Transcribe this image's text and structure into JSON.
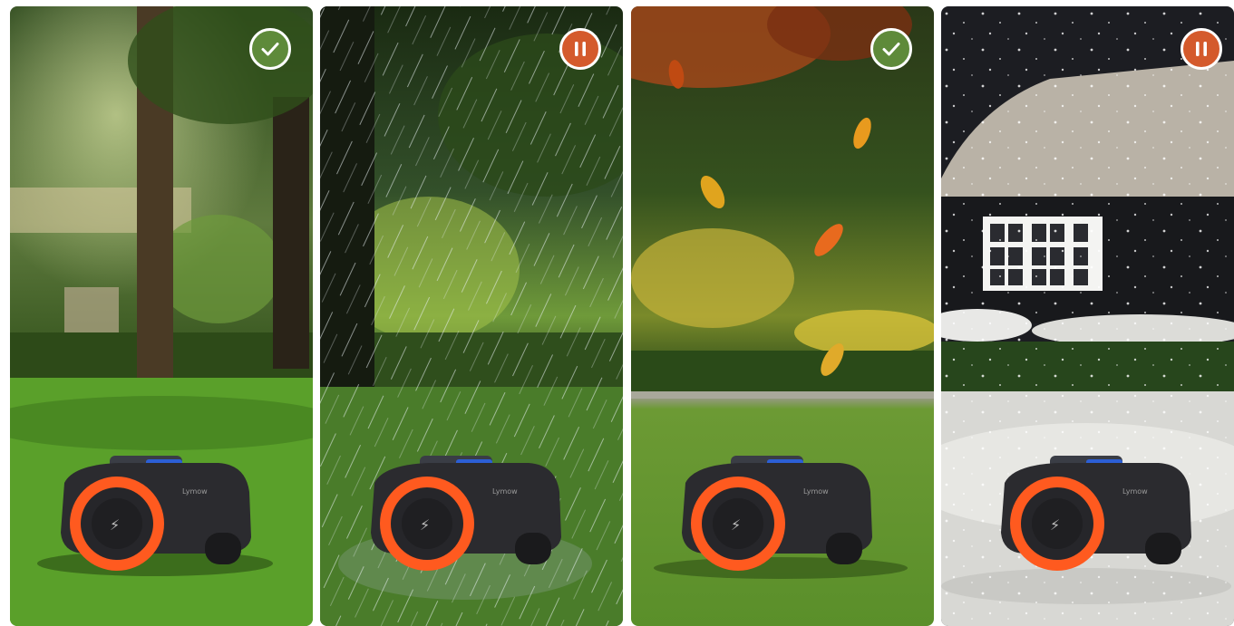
{
  "panels": [
    {
      "id": "sunny",
      "status": "mowing",
      "status_icon": "check-icon",
      "badge_color": "#5e8a3a"
    },
    {
      "id": "rain",
      "status": "paused",
      "status_icon": "pause-icon",
      "badge_color": "#d45a2c"
    },
    {
      "id": "autumn",
      "status": "mowing",
      "status_icon": "check-icon",
      "badge_color": "#5e8a3a"
    },
    {
      "id": "snow",
      "status": "paused",
      "status_icon": "pause-icon",
      "badge_color": "#d45a2c"
    }
  ],
  "mower": {
    "brand_text": "Lymow"
  },
  "colors": {
    "wheel": "#ff5a1f",
    "body": "#2b2b2f",
    "accent_blue": "#2c5fd6"
  }
}
